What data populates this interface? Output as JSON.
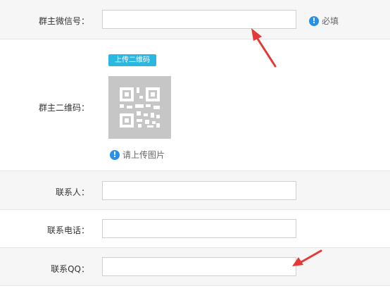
{
  "form": {
    "wechat_label": "群主微信号：",
    "wechat_value": "",
    "required_hint": "必填",
    "qrcode_label": "群主二维码：",
    "upload_button": "上传二维码",
    "upload_hint": "请上传图片",
    "contact_label": "联系人：",
    "contact_value": "",
    "phone_label": "联系电话：",
    "phone_value": "",
    "qq_label": "联系QQ：",
    "qq_value": ""
  },
  "icons": {
    "info": "info-circle-icon",
    "qr": "qr-code-icon",
    "arrow": "red-arrow-icon"
  },
  "colors": {
    "accent_blue": "#2a8fe8",
    "upload_button": "#2ab7e0",
    "annotation_red": "#e53935",
    "row_gray": "#f6f6f6"
  }
}
